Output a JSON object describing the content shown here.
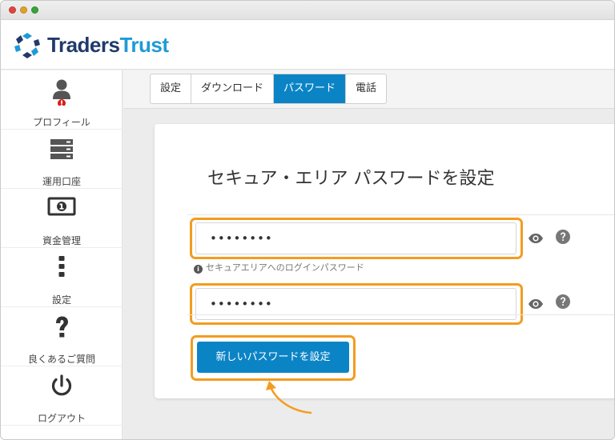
{
  "brand": {
    "name_part1": "Traders",
    "name_part2": "Trust"
  },
  "sidebar": {
    "items": [
      {
        "label": "プロフィール",
        "icon": "user-icon"
      },
      {
        "label": "運用口座",
        "icon": "server-icon"
      },
      {
        "label": "資金管理",
        "icon": "money-icon"
      },
      {
        "label": "設定",
        "icon": "vertical-dots-icon"
      },
      {
        "label": "良くあるご質問",
        "icon": "question-icon"
      },
      {
        "label": "ログアウト",
        "icon": "power-icon"
      }
    ]
  },
  "tabs": [
    {
      "label": "設定",
      "active": false
    },
    {
      "label": "ダウンロード",
      "active": false
    },
    {
      "label": "パスワード",
      "active": true
    },
    {
      "label": "電話",
      "active": false
    }
  ],
  "form": {
    "title": "セキュア・エリア パスワードを設定",
    "password_value": "••••••••",
    "password_hint": "セキュアエリアへのログインパスワード",
    "confirm_value": "••••••••",
    "submit_label": "新しいパスワードを設定"
  },
  "colors": {
    "accent": "#0b84c6",
    "highlight": "#f39c1f",
    "brand_dark": "#213a6b",
    "brand_light": "#1f9ad6",
    "alert": "#e01b1b"
  }
}
